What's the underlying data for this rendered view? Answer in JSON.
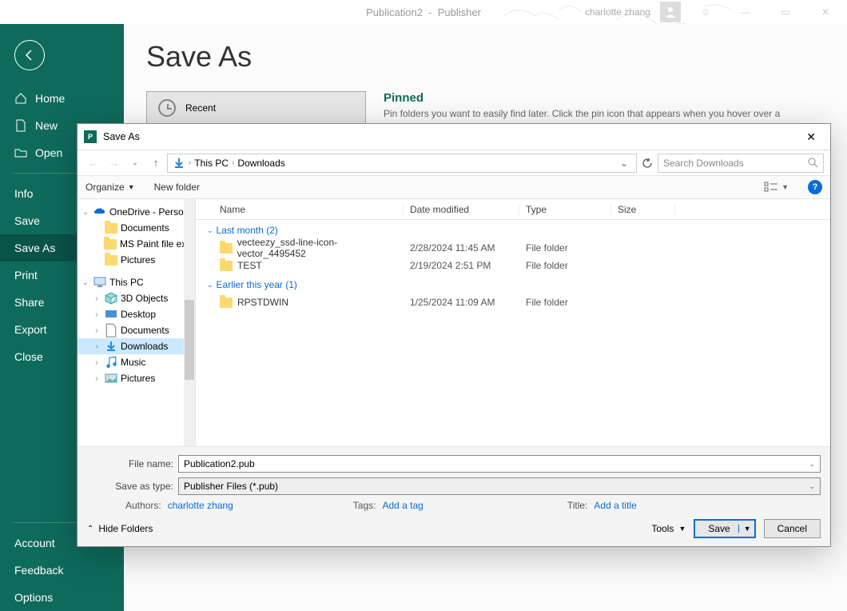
{
  "app": {
    "title_left": "Publication2",
    "title_right": "Publisher",
    "user_name": "charlotte zhang"
  },
  "leftnav": {
    "home": "Home",
    "new": "New",
    "open": "Open",
    "info": "Info",
    "save": "Save",
    "save_as": "Save As",
    "print": "Print",
    "share": "Share",
    "export": "Export",
    "close": "Close",
    "account": "Account",
    "feedback": "Feedback",
    "options": "Options"
  },
  "backstage": {
    "page_title": "Save As",
    "recent_label": "Recent",
    "pinned_title": "Pinned",
    "pinned_text": "Pin folders you want to easily find later. Click the pin icon that appears when you hover over a"
  },
  "dialog": {
    "title": "Save As",
    "breadcrumb_thispc": "This PC",
    "breadcrumb_folder": "Downloads",
    "search_placeholder": "Search Downloads",
    "organize": "Organize",
    "new_folder": "New folder",
    "columns": {
      "name": "Name",
      "date": "Date modified",
      "type": "Type",
      "size": "Size"
    },
    "tree": {
      "onedrive": "OneDrive - Persor",
      "od_docs": "Documents",
      "od_paint": "MS Paint file exa",
      "od_pics": "Pictures",
      "thispc": "This PC",
      "d3d": "3D Objects",
      "desktop": "Desktop",
      "docs": "Documents",
      "downloads": "Downloads",
      "music": "Music",
      "pics": "Pictures"
    },
    "groups": [
      {
        "label": "Last month (2)",
        "items": [
          {
            "name": "vecteezy_ssd-line-icon-vector_4495452",
            "date": "2/28/2024 11:45 AM",
            "type": "File folder"
          },
          {
            "name": "TEST",
            "date": "2/19/2024 2:51 PM",
            "type": "File folder"
          }
        ]
      },
      {
        "label": "Earlier this year (1)",
        "items": [
          {
            "name": "RPSTDWIN",
            "date": "1/25/2024 11:09 AM",
            "type": "File folder"
          }
        ]
      }
    ],
    "filename_label": "File name:",
    "filename_value": "Publication2.pub",
    "savetype_label": "Save as type:",
    "savetype_value": "Publisher Files (*.pub)",
    "authors_label": "Authors:",
    "authors_value": "charlotte zhang",
    "tags_label": "Tags:",
    "tags_value": "Add a tag",
    "title_label": "Title:",
    "title_value": "Add a title",
    "hide_folders": "Hide Folders",
    "tools": "Tools",
    "save_btn": "Save",
    "cancel_btn": "Cancel"
  }
}
